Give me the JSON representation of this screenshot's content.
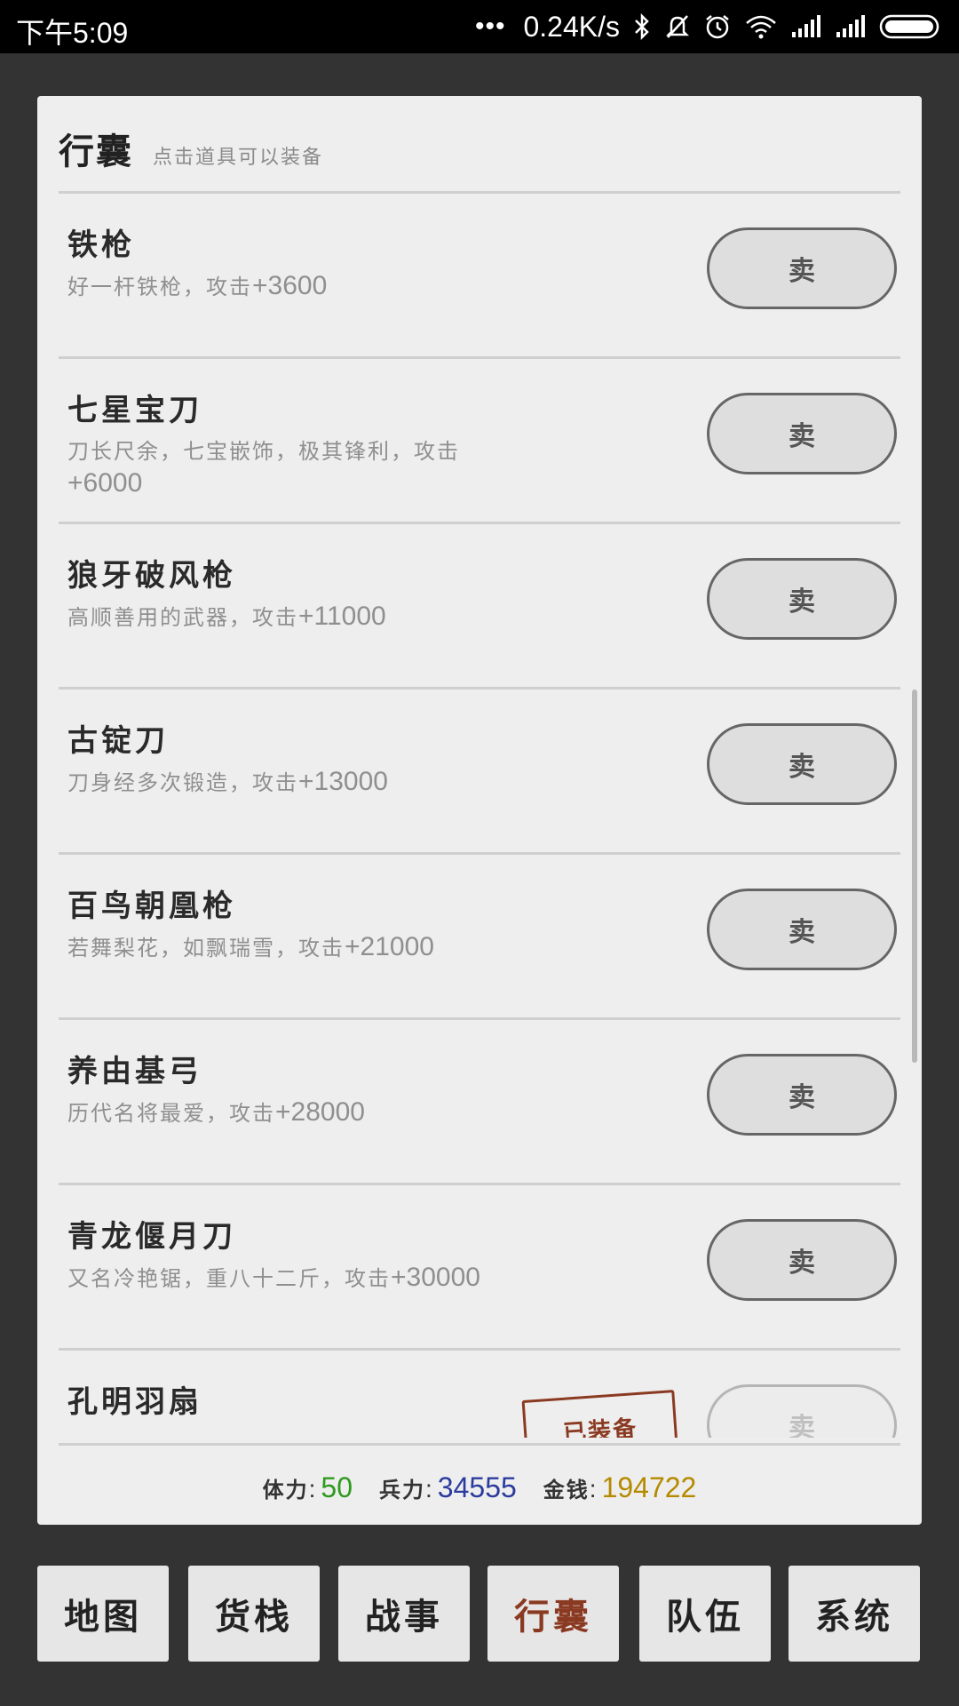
{
  "status_bar": {
    "time": "下午5:09",
    "dots": "•••",
    "speed": "0.24K/s",
    "icons": [
      "bluetooth-icon",
      "mute-bell-icon",
      "alarm-icon",
      "wifi-icon",
      "signal-icon",
      "signal-icon",
      "battery-icon"
    ]
  },
  "panel": {
    "title": "行囊",
    "hint": "点击道具可以装备"
  },
  "items": [
    {
      "name": "铁枪",
      "desc": "好一杆铁枪，攻击",
      "value": "+3600",
      "sell": "卖"
    },
    {
      "name": "七星宝刀",
      "desc": "刀长尺余，七宝嵌饰，极其锋利，攻击",
      "value": "+6000",
      "sell": "卖"
    },
    {
      "name": "狼牙破风枪",
      "desc": "高顺善用的武器，攻击",
      "value": "+11000",
      "sell": "卖"
    },
    {
      "name": "古锭刀",
      "desc": "刀身经多次锻造，攻击",
      "value": "+13000",
      "sell": "卖"
    },
    {
      "name": "百鸟朝凰枪",
      "desc": "若舞梨花，如飘瑞雪，攻击",
      "value": "+21000",
      "sell": "卖"
    },
    {
      "name": "养由基弓",
      "desc": "历代名将最爱，攻击",
      "value": "+28000",
      "sell": "卖"
    },
    {
      "name": "青龙偃月刀",
      "desc": "又名冷艳锯，重八十二斤，攻击",
      "value": "+30000",
      "sell": "卖"
    },
    {
      "name": "孔明羽扇",
      "desc": "",
      "value": "",
      "sell": "卖",
      "equipped": "已装备"
    }
  ],
  "stats": {
    "stamina_label": "体力",
    "stamina": "50",
    "troops_label": "兵力",
    "troops": "34555",
    "money_label": "金钱",
    "money": "194722",
    "colors": {
      "stamina": "#2e9a1e",
      "troops": "#2b3c9e",
      "money": "#b58a00"
    }
  },
  "nav": {
    "map": "地图",
    "shop": "货栈",
    "battle": "战事",
    "bag": "行囊",
    "team": "队伍",
    "system": "系统",
    "active": "bag"
  }
}
